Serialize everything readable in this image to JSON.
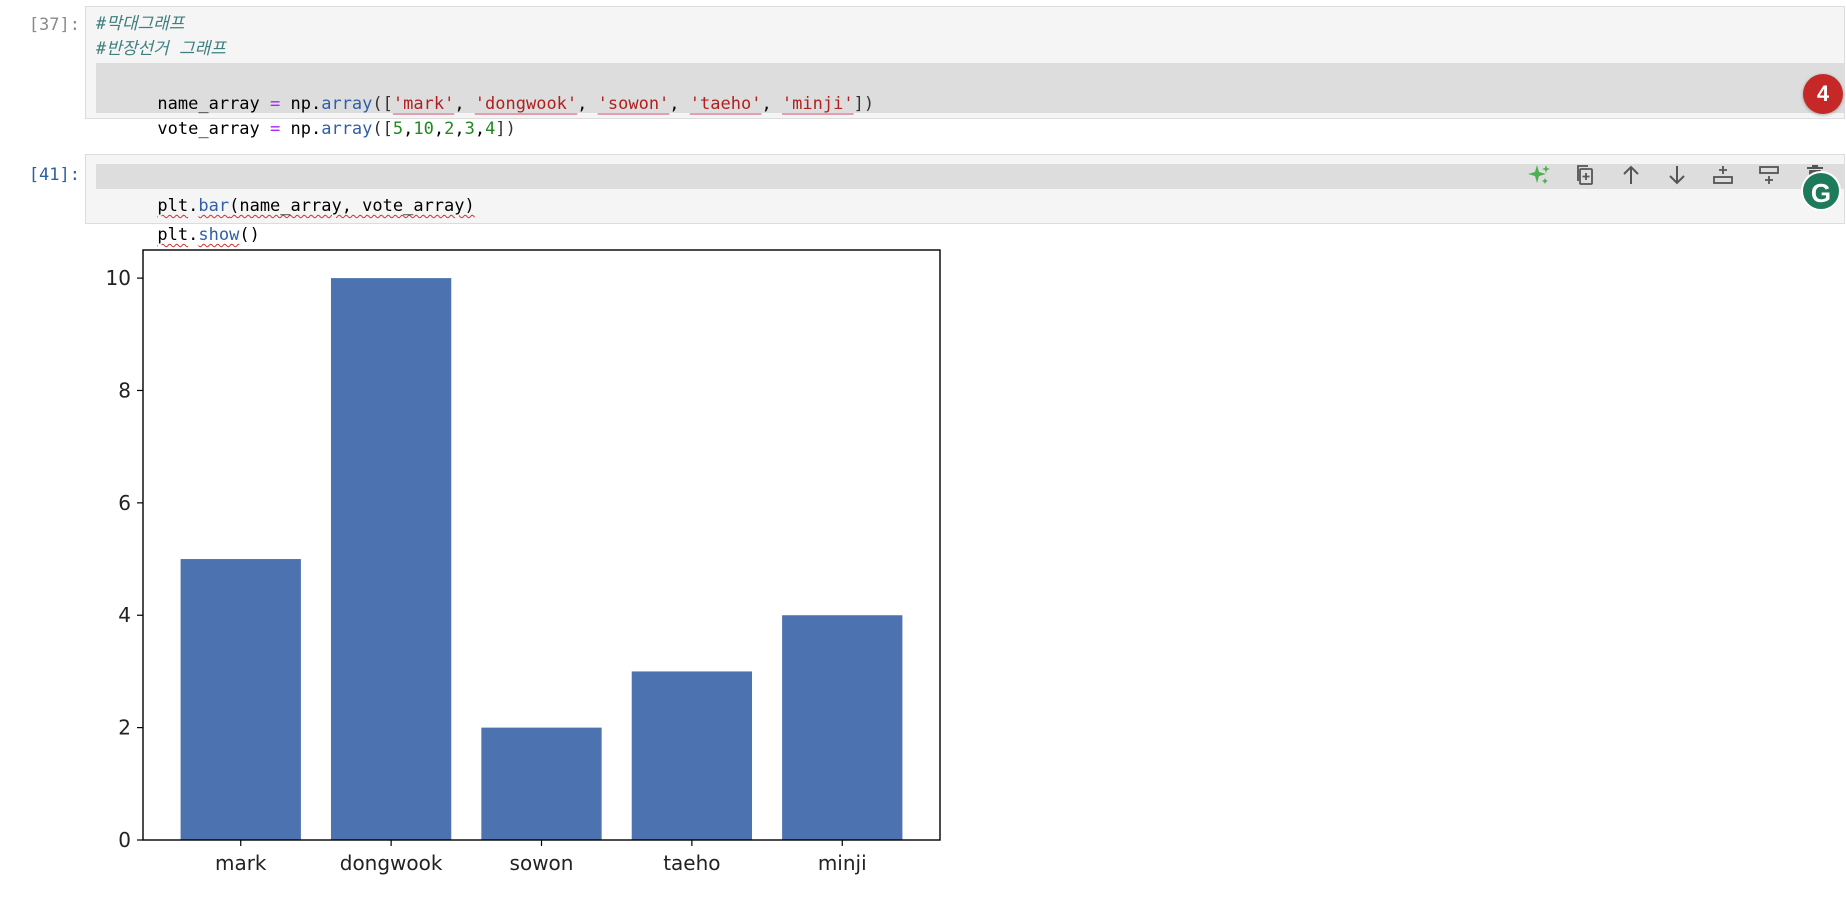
{
  "cells": [
    {
      "prompt": "[37]:",
      "comment1": "#막대그래프",
      "comment2": "#반장선거 그래프",
      "line3": {
        "var": "name_array",
        "op": " = ",
        "mod": "np.",
        "fn": "array",
        "open": "([",
        "items": [
          "'mark'",
          "'dongwook'",
          "'sowon'",
          "'taeho'",
          "'minji'"
        ],
        "sep": ", ",
        "close": "])"
      },
      "line4": {
        "var": "vote_array",
        "op": " = ",
        "mod": "np.",
        "fn": "array",
        "open": "([",
        "items": [
          "5",
          "10",
          "2",
          "3",
          "4"
        ],
        "sep": ",",
        "close": "])"
      },
      "badge": "4"
    },
    {
      "prompt": "[41]:",
      "line1": {
        "mod": "plt",
        "dot": ".",
        "fn": "bar",
        "args": "(name_array, vote_array)"
      },
      "line2": {
        "mod": "plt",
        "dot": ".",
        "fn": "show",
        "args": "()"
      },
      "toolbar": [
        "sparkle-icon",
        "duplicate-icon",
        "move-up-icon",
        "move-down-icon",
        "insert-above-icon",
        "insert-below-icon",
        "delete-icon"
      ],
      "grammarly_badge": "G"
    }
  ],
  "chart_data": {
    "type": "bar",
    "categories": [
      "mark",
      "dongwook",
      "sowon",
      "taeho",
      "minji"
    ],
    "values": [
      5,
      10,
      2,
      3,
      4
    ],
    "ylim": [
      0,
      10.5
    ],
    "yticks": [
      0,
      2,
      4,
      6,
      8,
      10
    ],
    "bar_color": "#4c72b0",
    "grid": false
  },
  "colors": {
    "accent_badge": "#c62828",
    "grammarly": "#1d7a5a",
    "sparkle": "#4caf50"
  }
}
